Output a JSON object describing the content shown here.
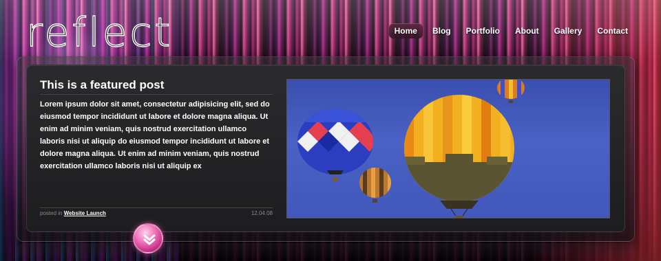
{
  "site": {
    "logo_text": "reflect"
  },
  "nav": {
    "items": [
      {
        "label": "Home",
        "active": true
      },
      {
        "label": "Blog",
        "active": false
      },
      {
        "label": "Portfolio",
        "active": false
      },
      {
        "label": "About",
        "active": false
      },
      {
        "label": "Gallery",
        "active": false
      },
      {
        "label": "Contact",
        "active": false
      }
    ]
  },
  "featured_post": {
    "title": "This is a featured post",
    "body": "Lorem ipsum dolor sit amet, consectetur adipisicing elit, sed do eiusmod tempor incididunt ut labore et dolore magna aliqua. Ut enim ad minim veniam, quis nostrud exercitation ullamco laboris nisi ut aliquip do eiusmod tempor incididunt ut labore et dolore magna aliqua. Ut enim ad minim veniam, quis nostrud exercitation ullamco laboris nisi ut aliquip ex",
    "meta_prefix": "posted in",
    "category": "Website Launch",
    "date": "12.04.08",
    "image_subject": "hot-air-balloons"
  },
  "controls": {
    "scroll_icon": "chevron-down-icon"
  },
  "colors": {
    "accent_pink": "#e0509a",
    "panel_bg": "#252528",
    "sky_blue": "#4258bc"
  }
}
